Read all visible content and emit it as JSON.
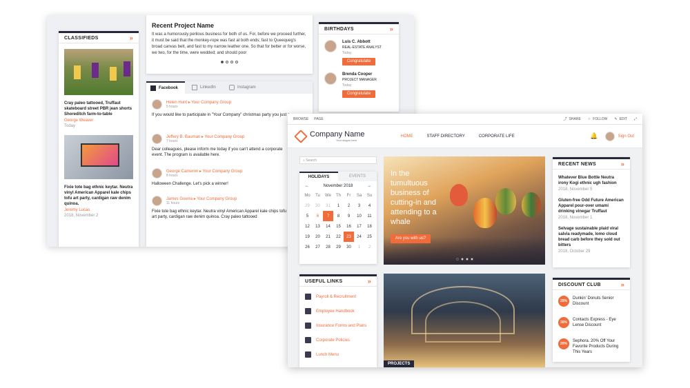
{
  "classifieds": {
    "title": "CLASSIFIEDS",
    "items": [
      {
        "text": "Cray paleo tattooed, Truffaut skateboard street PBR jean shorts Shoreditch farm-to-table",
        "author": "George Weaver",
        "date": "Today"
      },
      {
        "text": "Fixie tote bag ethnic keytar. Neutra vinyl American Apparel kale chips tofu art party, cardigan raw denim quinoa.",
        "author": "Jeremy Lucas",
        "date": "2018, November 2"
      }
    ]
  },
  "project": {
    "title": "Recent Project Name",
    "body": "It was a humorously perilous business for both of us. For, before we proceed further, it must be said that the monkey-rope was fast at both ends; fast to Queequeg's broad canvas belt, and fast to my narrow leather one. So that for better or for worse, we two, for the time, were wedded; and should poor"
  },
  "social": {
    "tabs": [
      "Facebook",
      "LinkedIn",
      "Instagram"
    ],
    "posts": [
      {
        "name": "Helen Hunt",
        "group": "Your Company Group",
        "time": "5 hours",
        "text": "If you would like to participate in \"Your Company\" christmas party you just some days left to vote"
      },
      {
        "name": "Jeffery B. Bauman",
        "group": "Your Company Group",
        "time": "7 hours",
        "text": "Dear colleagues, please inform me today if you can't attend a corporate event. The program is available here."
      },
      {
        "name": "George Cameron",
        "group": "Your Company Group",
        "time": "8 hours",
        "text": "Halloween Challenge. Let's pick a winner!"
      },
      {
        "name": "James Guerra",
        "group": "Your Company Group",
        "time": "11 hours",
        "text": "Fixie tote bag ethnic keytar. Neutra vinyl American Apparel kale chips tofu art party, cardigan raw denim quinoa. Cray paleo tattooed"
      }
    ]
  },
  "birthdays": {
    "title": "BIRTHDAYS",
    "people": [
      {
        "name": "Luis C. Abbott",
        "role": "REAL-ESTATE ANALYST",
        "date": "Today",
        "button": "Congratulate"
      },
      {
        "name": "Brenda Cooper",
        "role": "PROJECT MANAGER",
        "date": "Today",
        "button": "Congratulate"
      }
    ]
  },
  "topbar": {
    "left": [
      "BROWSE",
      "PAGE"
    ],
    "share": "SHARE",
    "follow": "FOLLOW",
    "edit": "EDIT"
  },
  "header": {
    "company": "Company Name",
    "slogan": "Your slogan here",
    "nav": [
      "HOME",
      "STAFF DIRECTORY",
      "CORPORATE LIFE"
    ],
    "signout": "Sign Out"
  },
  "search": {
    "placeholder": "Search"
  },
  "calendar": {
    "tabs": [
      "HOLIDAYS",
      "EVENTS"
    ],
    "month": "November 2018",
    "weekdays": [
      "Mo",
      "Tu",
      "We",
      "Th",
      "Fr",
      "Sa",
      "Su"
    ],
    "weeks": [
      [
        "29",
        "30",
        "31",
        "1",
        "2",
        "3",
        "4"
      ],
      [
        "5",
        "6",
        "7",
        "8",
        "9",
        "10",
        "11"
      ],
      [
        "12",
        "13",
        "14",
        "15",
        "16",
        "17",
        "18"
      ],
      [
        "19",
        "20",
        "21",
        "22",
        "23",
        "24",
        "25"
      ],
      [
        "26",
        "27",
        "28",
        "29",
        "30",
        "1",
        "2"
      ]
    ]
  },
  "hero": {
    "title": "In the tumultuous business of cutting-in and attending to a whale",
    "button": "Are you with us?"
  },
  "projects": {
    "label": "PROJECTS"
  },
  "useful_links": {
    "title": "USEFUL LINKS",
    "items": [
      "Payroll & Recruitment",
      "Employee Handbook",
      "Insurance Forms and Plans",
      "Corporate Policies",
      "Lunch Menu"
    ]
  },
  "recent_news": {
    "title": "RECENT NEWS",
    "items": [
      {
        "text": "Whatever Blue Bottle Neutra irony Kogi ethnic ugh fashion",
        "date": "2018, November 5"
      },
      {
        "text": "Gluten-free Odd Future American Apparel pour-over umami drinking vinegar Truffaut",
        "date": "2018, November 1"
      },
      {
        "text": "Selvage sustainable plaid viral salvia readymade, lomo cloud bread carb before they sold out bitters",
        "date": "2018, October 29"
      }
    ]
  },
  "discount": {
    "title": "DISCOUNT CLUB",
    "items": [
      {
        "pct": "25%",
        "text": "Dunkin' Donuts Senior Discount"
      },
      {
        "pct": "30%",
        "text": "Contacts Express - Eye Lense Discount"
      },
      {
        "pct": "20%",
        "text": "Sephora. 20% Off Your Favorite Products During This Years"
      }
    ]
  },
  "colors": {
    "accent": "#f26b3a",
    "dark": "#26283a"
  }
}
